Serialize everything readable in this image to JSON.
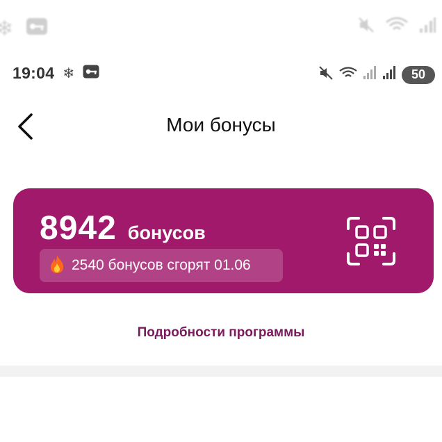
{
  "ghost_status": {
    "icons": [
      "snowflake-icon",
      "key-icon",
      "mute-icon",
      "wifi-icon",
      "signal-icon"
    ]
  },
  "status_bar": {
    "time": "19:04",
    "battery": "50",
    "icons": [
      "snowflake-icon",
      "key-icon",
      "mute-icon",
      "wifi-icon",
      "signal-icon",
      "signal-icon"
    ]
  },
  "header": {
    "title": "Мои бонусы",
    "back_icon": "chevron-left-icon"
  },
  "bonus_card": {
    "amount": "8942",
    "unit": "бонусов",
    "burn_text": "2540 бонусов сгорят 01.06",
    "burn_icon": "fire-icon",
    "qr_icon": "qr-code-icon",
    "color": "#a0196b"
  },
  "links": {
    "program_details": "Подробности программы"
  }
}
